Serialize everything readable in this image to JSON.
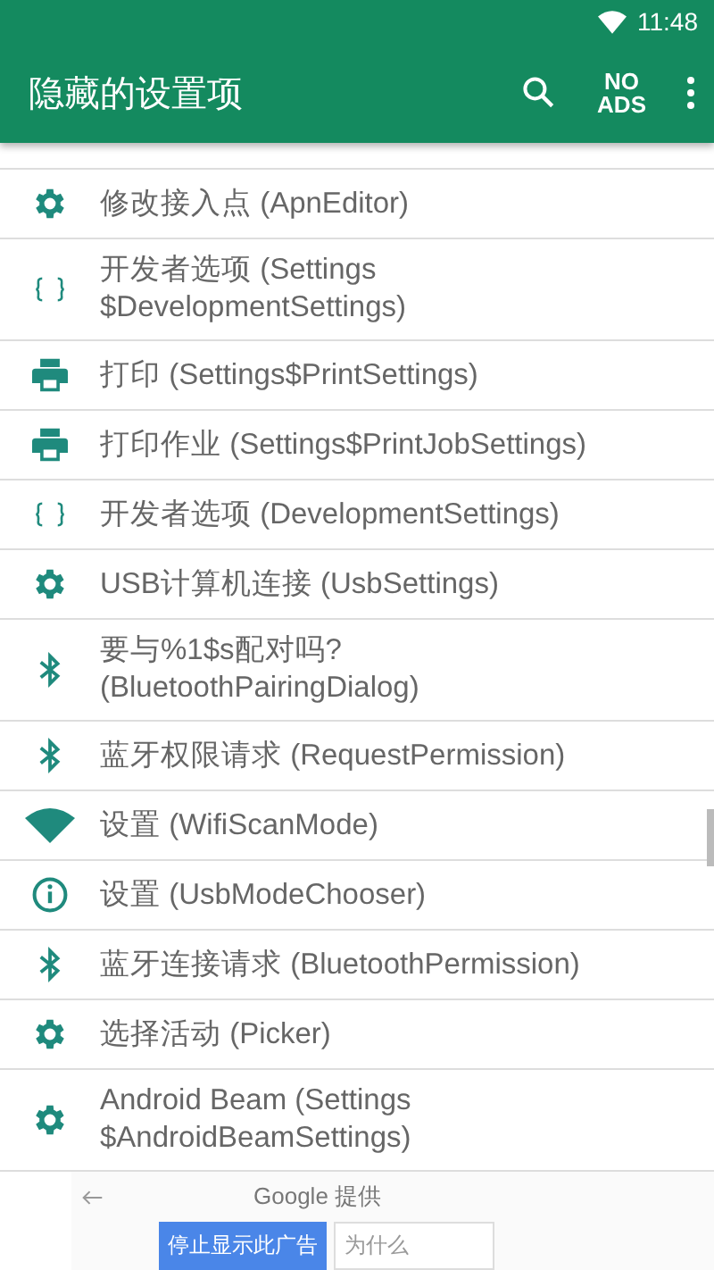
{
  "status_bar": {
    "time": "11:48"
  },
  "app_bar": {
    "title": "隐藏的设置项",
    "no_ads": "NO\nADS"
  },
  "items": [
    {
      "kind": "gear",
      "label": "修改接入点 (ApnEditor)"
    },
    {
      "kind": "braces",
      "label": "开发者选项 (Settings\n$DevelopmentSettings)"
    },
    {
      "kind": "printer",
      "label": "打印 (Settings$PrintSettings)"
    },
    {
      "kind": "printer",
      "label": "打印作业 (Settings$PrintJobSettings)"
    },
    {
      "kind": "braces",
      "label": "开发者选项 (DevelopmentSettings)"
    },
    {
      "kind": "gear",
      "label": "USB计算机连接 (UsbSettings)"
    },
    {
      "kind": "bluetooth",
      "label": "要与%1$s配对吗?\n(BluetoothPairingDialog)"
    },
    {
      "kind": "bluetooth",
      "label": "蓝牙权限请求 (RequestPermission)"
    },
    {
      "kind": "wifi",
      "label": "设置 (WifiScanMode)"
    },
    {
      "kind": "info",
      "label": "设置 (UsbModeChooser)"
    },
    {
      "kind": "bluetooth",
      "label": "蓝牙连接请求 (BluetoothPermission)"
    },
    {
      "kind": "gear",
      "label": "选择活动 (Picker)"
    },
    {
      "kind": "gear",
      "label": "Android Beam (Settings\n$AndroidBeamSettings)"
    }
  ],
  "ad": {
    "provider": "Google 提供",
    "stop_button": "停止显示此广告",
    "why_button": "为什么"
  }
}
